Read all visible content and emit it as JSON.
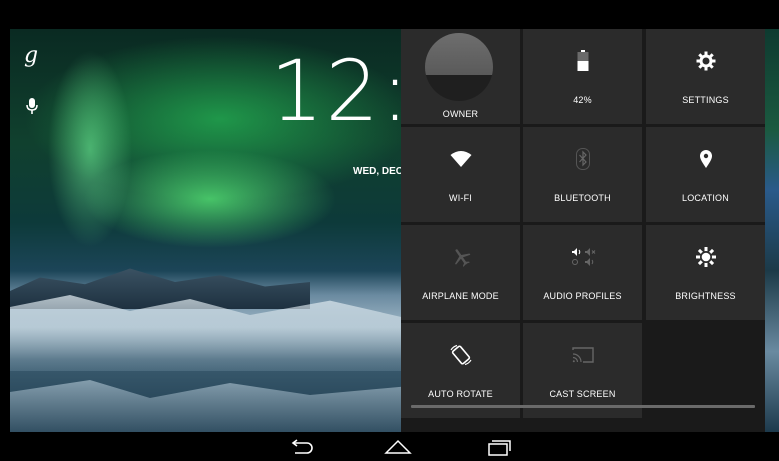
{
  "lockscreen": {
    "clock": "12:",
    "date": "WED, DEC"
  },
  "quick_settings": {
    "tiles": [
      {
        "label": "OWNER",
        "icon": "avatar"
      },
      {
        "label": "42%",
        "icon": "battery-icon"
      },
      {
        "label": "SETTINGS",
        "icon": "gear-icon"
      },
      {
        "label": "WI-FI",
        "icon": "wifi-icon"
      },
      {
        "label": "BLUETOOTH",
        "icon": "bluetooth-icon"
      },
      {
        "label": "LOCATION",
        "icon": "location-pin-icon"
      },
      {
        "label": "AIRPLANE MODE",
        "icon": "airplane-icon"
      },
      {
        "label": "AUDIO PROFILES",
        "icon": "audio-profiles-icon"
      },
      {
        "label": "BRIGHTNESS",
        "icon": "brightness-icon"
      },
      {
        "label": "AUTO ROTATE",
        "icon": "auto-rotate-icon"
      },
      {
        "label": "CAST SCREEN",
        "icon": "cast-icon"
      }
    ],
    "battery_level": 0.42
  },
  "navbar": {
    "buttons": [
      "back-icon",
      "home-icon",
      "recents-icon"
    ]
  },
  "colors": {
    "panel_bg": "#1a1a1a",
    "tile_bg": "#2b2b2b",
    "text": "#ffffff",
    "disabled_icon": "#5c5c5c"
  }
}
